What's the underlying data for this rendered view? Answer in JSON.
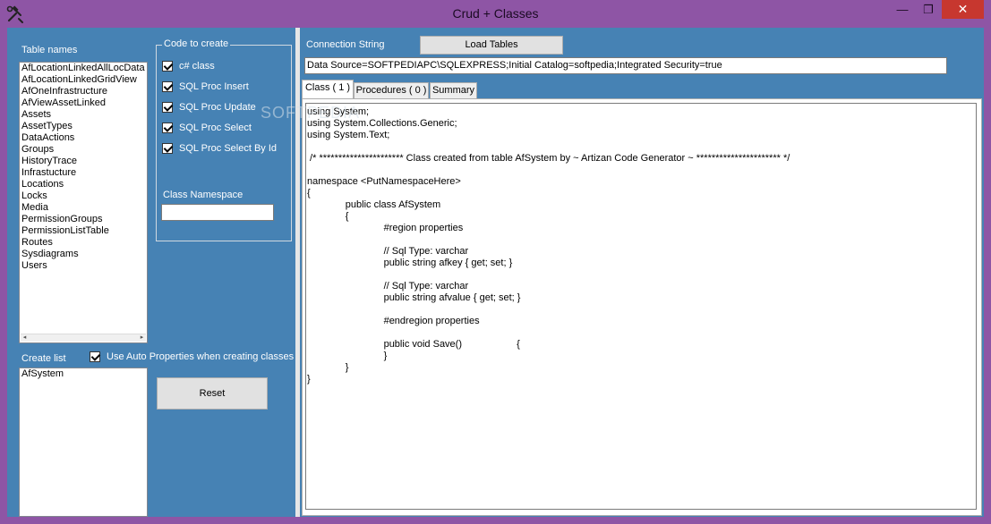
{
  "window": {
    "title": "Crud + Classes",
    "minimize_glyph": "—",
    "maximize_glyph": "❐",
    "close_glyph": "✕",
    "app_icon": "tools-icon"
  },
  "left": {
    "table_names_label": "Table names",
    "table_names": [
      "AfLocationLinkedAllLocData",
      "AfLocationLinkedGridView",
      "AfOneInfrastructure",
      "AfViewAssetLinked",
      "Assets",
      "AssetTypes",
      "DataActions",
      "Groups",
      "HistoryTrace",
      "Infrastucture",
      "Locations",
      "Locks",
      "Media",
      "PermissionGroups",
      "PermissionListTable",
      "Routes",
      "Sysdiagrams",
      "Users"
    ],
    "create_list_label": "Create list",
    "create_list": [
      "AfSystem"
    ],
    "auto_properties_label": "Use Auto Properties when creating classes",
    "auto_properties_checked": true,
    "reset_label": "Reset"
  },
  "code_to_create": {
    "legend": "Code to create",
    "options": [
      {
        "label": "c# class",
        "checked": true
      },
      {
        "label": "SQL Proc Insert",
        "checked": true
      },
      {
        "label": "SQL Proc Update",
        "checked": true
      },
      {
        "label": "SQL Proc Select",
        "checked": true
      },
      {
        "label": "SQL Proc Select By Id",
        "checked": true
      }
    ],
    "namespace_label": "Class Namespace",
    "namespace_value": ""
  },
  "right": {
    "connection_label": "Connection String",
    "load_tables_label": "Load Tables",
    "connection_value": "Data Source=SOFTPEDIAPC\\SQLEXPRESS;Initial Catalog=softpedia;Integrated Security=true",
    "tabs": [
      {
        "label": "Class ( 1 )",
        "active": true
      },
      {
        "label": "Procedures ( 0 )",
        "active": false
      },
      {
        "label": "Summary",
        "active": false
      }
    ],
    "code_lines": [
      "using System;",
      "using System.Collections.Generic;",
      "using System.Text;",
      "",
      " /* ********************** Class created from table AfSystem by ~ Artizan Code Generator ~ ********************** */",
      "",
      "namespace <PutNamespaceHere>",
      "{",
      "              public class AfSystem",
      "              {",
      "                            #region properties",
      "",
      "                            // Sql Type: varchar",
      "                            public string afkey { get; set; }",
      "",
      "                            // Sql Type: varchar",
      "                            public string afvalue { get; set; }",
      "",
      "                            #endregion properties",
      "",
      "                            public void Save()                    {",
      "                            }",
      "              }",
      "}"
    ]
  },
  "watermark": "SOFTPEDIA"
}
